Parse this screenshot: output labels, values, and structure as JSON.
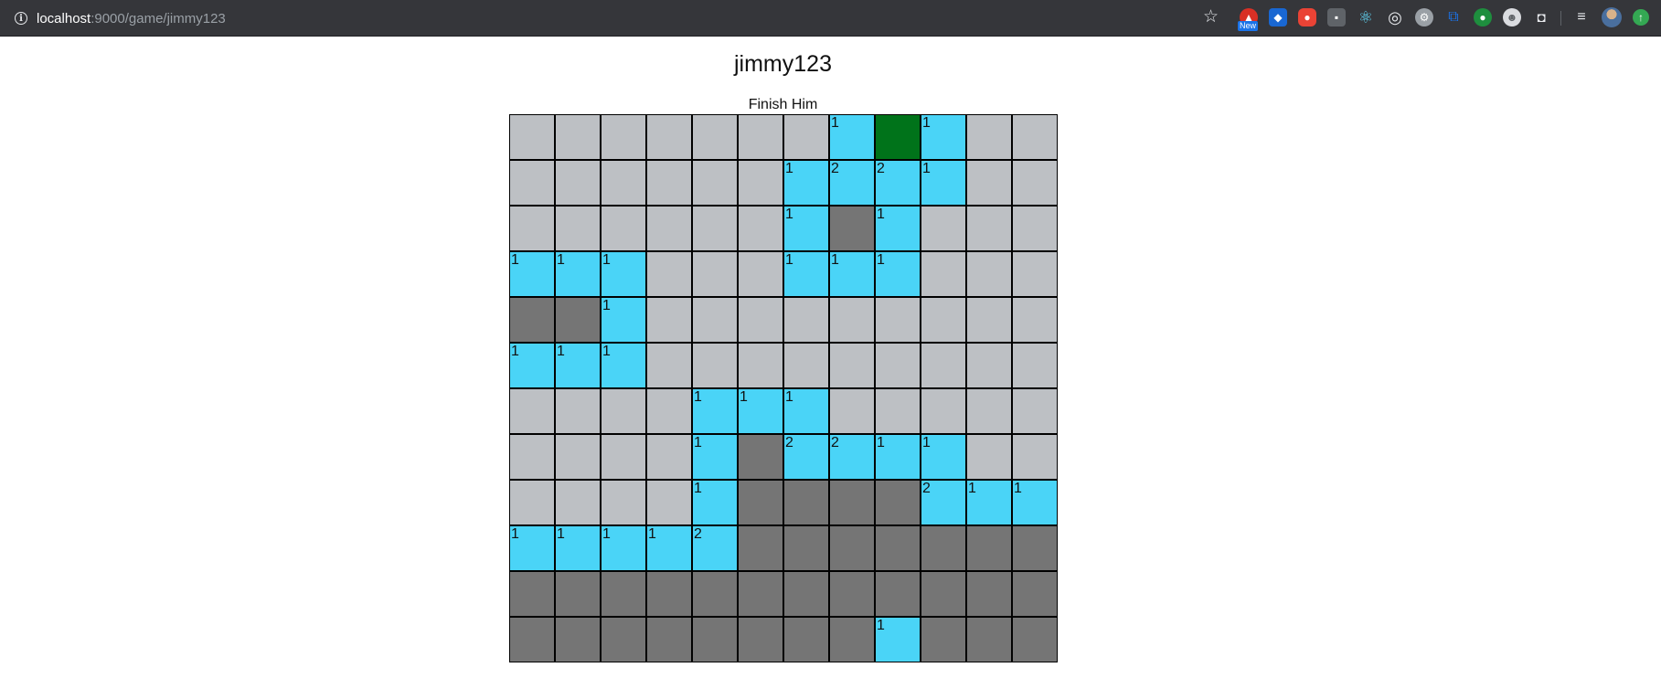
{
  "browser": {
    "url_host": "localhost",
    "url_rest": ":9000/game/jimmy123",
    "new_badge": "New"
  },
  "game": {
    "title": "jimmy123",
    "status": "Finish Him",
    "colors": {
      "hidden": "#bdc0c4",
      "revealed_empty": "#757575",
      "revealed_number": "#4ad4f7",
      "flagged": "#00731a"
    },
    "board_legend": "H = hidden, E = revealed empty, F = flagged, digit = revealed number",
    "board": [
      [
        "H",
        "H",
        "H",
        "H",
        "H",
        "H",
        "H",
        "1",
        "F",
        "1",
        "H",
        "H"
      ],
      [
        "H",
        "H",
        "H",
        "H",
        "H",
        "H",
        "1",
        "2",
        "2",
        "1",
        "H",
        "H"
      ],
      [
        "H",
        "H",
        "H",
        "H",
        "H",
        "H",
        "1",
        "E",
        "1",
        "H",
        "H",
        "H"
      ],
      [
        "1",
        "1",
        "1",
        "H",
        "H",
        "H",
        "1",
        "1",
        "1",
        "H",
        "H",
        "H"
      ],
      [
        "E",
        "E",
        "1",
        "H",
        "H",
        "H",
        "H",
        "H",
        "H",
        "H",
        "H",
        "H"
      ],
      [
        "1",
        "1",
        "1",
        "H",
        "H",
        "H",
        "H",
        "H",
        "H",
        "H",
        "H",
        "H"
      ],
      [
        "H",
        "H",
        "H",
        "H",
        "1",
        "1",
        "1",
        "H",
        "H",
        "H",
        "H",
        "H"
      ],
      [
        "H",
        "H",
        "H",
        "H",
        "1",
        "E",
        "2",
        "2",
        "1",
        "1",
        "H",
        "H"
      ],
      [
        "H",
        "H",
        "H",
        "H",
        "1",
        "E",
        "E",
        "E",
        "E",
        "2",
        "1",
        "1"
      ],
      [
        "1",
        "1",
        "1",
        "1",
        "2",
        "E",
        "E",
        "E",
        "E",
        "E",
        "E",
        "E"
      ],
      [
        "E",
        "E",
        "E",
        "E",
        "E",
        "E",
        "E",
        "E",
        "E",
        "E",
        "E",
        "E"
      ],
      [
        "E",
        "E",
        "E",
        "E",
        "E",
        "E",
        "E",
        "E",
        "1",
        "E",
        "E",
        "E"
      ]
    ]
  }
}
